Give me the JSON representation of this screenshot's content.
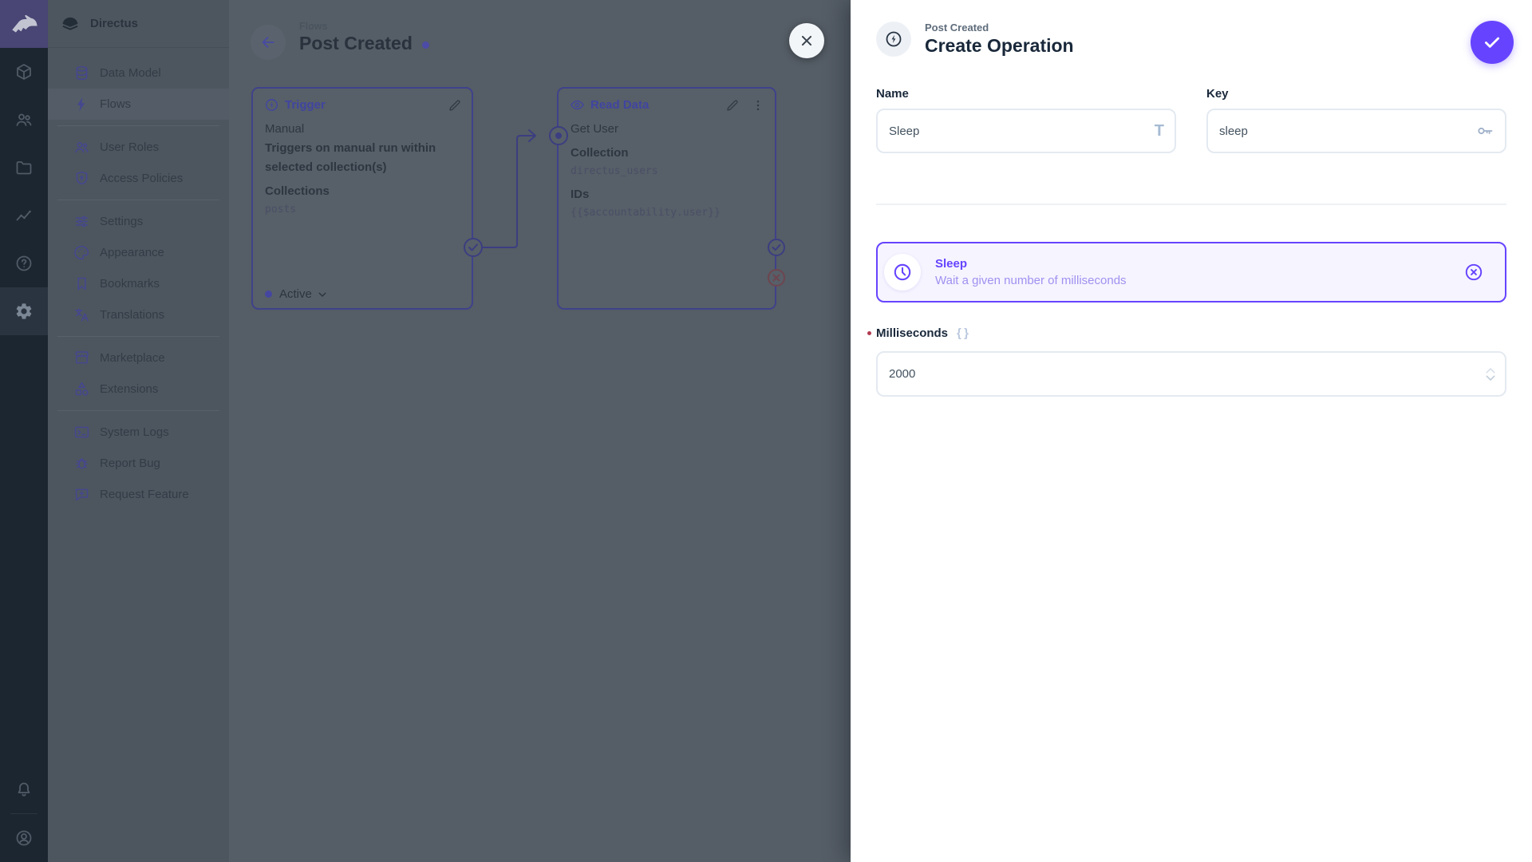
{
  "colors": {
    "accent": "#6644ff"
  },
  "module_bar": {
    "modules": [
      {
        "icon": "box-icon"
      },
      {
        "icon": "users-icon"
      },
      {
        "icon": "folder-icon"
      },
      {
        "icon": "insights-icon"
      },
      {
        "icon": "help-icon"
      },
      {
        "icon": "gear-icon",
        "active": true
      }
    ],
    "bottom": [
      {
        "icon": "bell-icon"
      },
      {
        "icon": "account-icon"
      }
    ]
  },
  "sidebar": {
    "project_name": "Directus",
    "items": [
      {
        "label": "Data Model",
        "icon": "database-icon"
      },
      {
        "label": "Flows",
        "icon": "bolt-icon",
        "active": true
      },
      {
        "label": "User Roles",
        "icon": "users-icon"
      },
      {
        "label": "Access Policies",
        "icon": "shield-icon"
      },
      {
        "label": "Settings",
        "icon": "tune-icon"
      },
      {
        "label": "Appearance",
        "icon": "palette-icon"
      },
      {
        "label": "Bookmarks",
        "icon": "bookmark-icon"
      },
      {
        "label": "Translations",
        "icon": "translate-icon"
      },
      {
        "label": "Marketplace",
        "icon": "storefront-icon"
      },
      {
        "label": "Extensions",
        "icon": "shapes-icon"
      },
      {
        "label": "System Logs",
        "icon": "terminal-icon"
      },
      {
        "label": "Report Bug",
        "icon": "bug-icon"
      },
      {
        "label": "Request Feature",
        "icon": "feedback-icon"
      }
    ]
  },
  "canvas": {
    "breadcrumb": "Flows",
    "title": "Post Created",
    "trigger_panel": {
      "title": "Trigger",
      "name": "Manual",
      "description": "Triggers on manual run within selected collection(s)",
      "option_label": "Collections",
      "option_value": "posts",
      "status": "Active"
    },
    "operation_panel": {
      "title": "Read Data",
      "name": "Get User",
      "field1_label": "Collection",
      "field1_value": "directus_users",
      "field2_label": "IDs",
      "field2_value": "{{$accountability.user}}"
    }
  },
  "drawer": {
    "breadcrumb": "Post Created",
    "title": "Create Operation",
    "name_field": {
      "label": "Name",
      "value": "Sleep"
    },
    "key_field": {
      "label": "Key",
      "value": "sleep"
    },
    "operation_card": {
      "title": "Sleep",
      "description": "Wait a given number of milliseconds"
    },
    "milliseconds_field": {
      "label": "Milliseconds",
      "value": "2000"
    }
  }
}
